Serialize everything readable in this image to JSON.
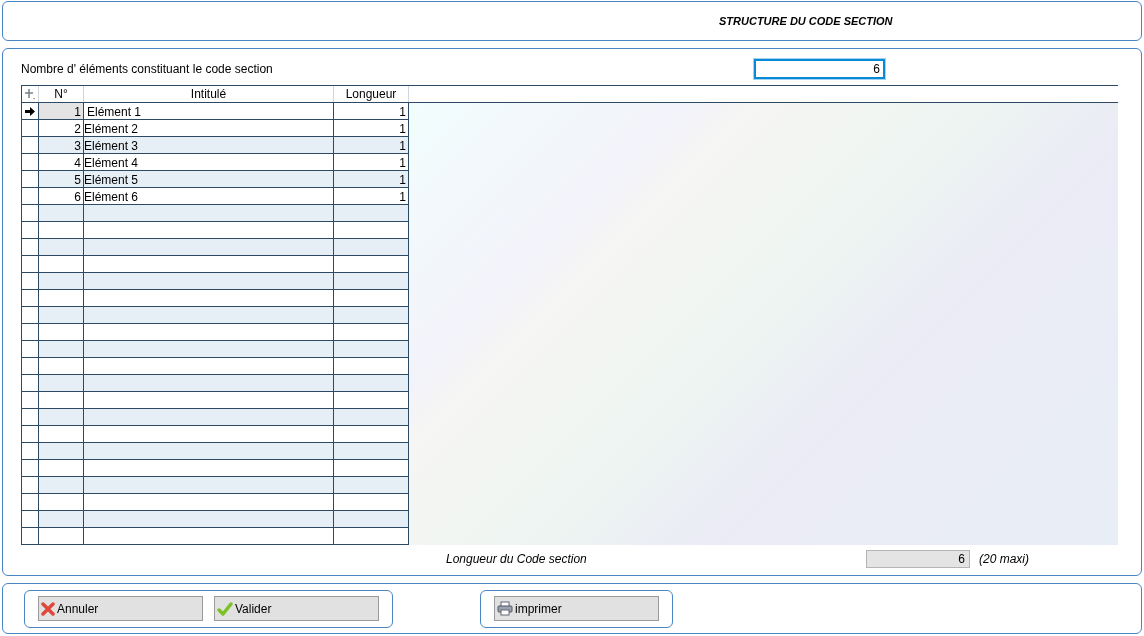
{
  "header": {
    "title": "STRUCTURE DU CODE SECTION"
  },
  "count": {
    "label": "Nombre d' éléments constituant le code section",
    "value": "6"
  },
  "table": {
    "columns": [
      "N°",
      "Intitulé",
      "Longueur"
    ],
    "rows": [
      {
        "number": "1",
        "label": "Elément 1",
        "length": "1",
        "selected": true
      },
      {
        "number": "2",
        "label": "Elément 2",
        "length": "1",
        "selected": false
      },
      {
        "number": "3",
        "label": "Elément 3",
        "length": "1",
        "selected": false
      },
      {
        "number": "4",
        "label": "Elément 4",
        "length": "1",
        "selected": false
      },
      {
        "number": "5",
        "label": "Elément 5",
        "length": "1",
        "selected": false
      },
      {
        "number": "6",
        "label": "Elément 6",
        "length": "1",
        "selected": false
      }
    ]
  },
  "total": {
    "label": "Longueur du Code section",
    "value": "6",
    "note": "(20 maxi)"
  },
  "button_groups": [
    [
      {
        "kind": "cancel",
        "label": "Annuler"
      },
      {
        "kind": "validate",
        "label": "Valider"
      }
    ],
    [
      {
        "kind": "print",
        "label": "imprimer"
      }
    ]
  ]
}
